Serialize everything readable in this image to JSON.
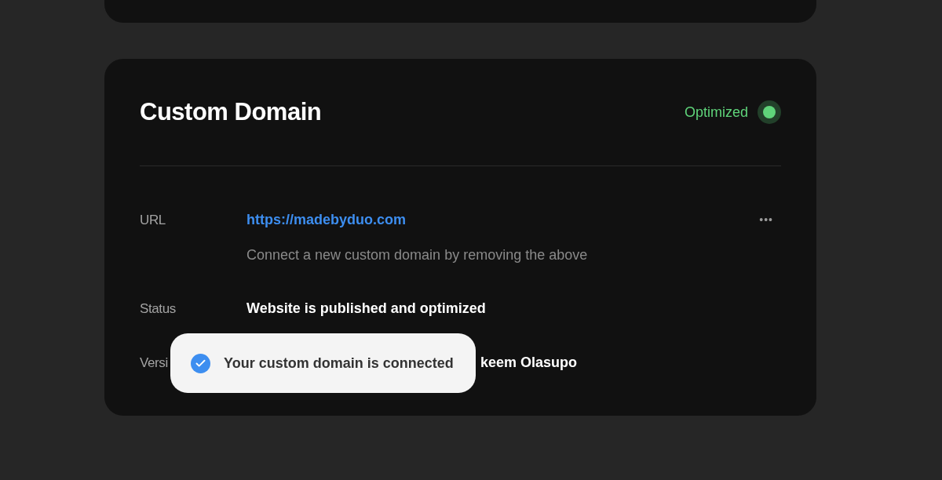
{
  "card": {
    "title": "Custom Domain",
    "status": {
      "label": "Optimized"
    },
    "rows": [
      {
        "kind": "link",
        "label": "URL",
        "value": "https://madebyduo.com",
        "hint": "Connect a new custom domain by removing the above",
        "menu": "•••"
      },
      {
        "kind": "text",
        "label": "Status",
        "value": "Website is published and optimized"
      },
      {
        "kind": "covered",
        "label": "Versi",
        "value": "keem Olasupo"
      }
    ]
  },
  "toast": {
    "message": "Your custom domain is connected"
  }
}
